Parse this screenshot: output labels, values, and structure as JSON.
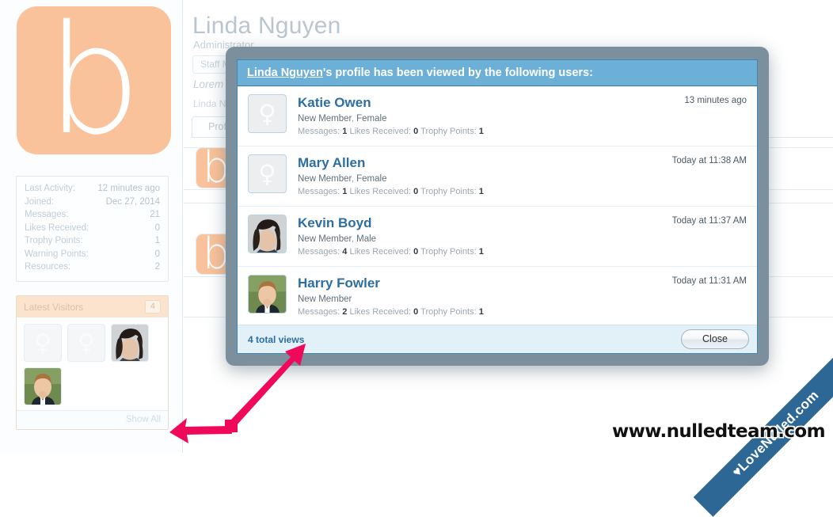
{
  "profile": {
    "username": "Linda Nguyen",
    "user_title": "Administrator",
    "staff_badge": "Staff Member",
    "tagline": "Lorem ipsum dolor sit amet",
    "subline": "Linda Nguyen",
    "avatar_letter": "b",
    "avatar_color": "#fac29a",
    "tab_profile": "Profile"
  },
  "stats": {
    "rows": [
      {
        "label": "Last Activity:",
        "value": "12 minutes ago"
      },
      {
        "label": "Joined:",
        "value": "Dec 27, 2014"
      },
      {
        "label": "Messages:",
        "value": "21"
      },
      {
        "label": "Likes Received:",
        "value": "0"
      },
      {
        "label": "Trophy Points:",
        "value": "1"
      },
      {
        "label": "Warning Points:",
        "value": "0"
      },
      {
        "label": "Resources:",
        "value": "2"
      }
    ]
  },
  "visitors": {
    "title": "Latest Visitors",
    "count": "4",
    "show_all": "Show All",
    "thumbs": [
      {
        "type": "female-symbol",
        "symbol": "♀"
      },
      {
        "type": "female-symbol",
        "symbol": "♀"
      },
      {
        "type": "photo-dark-hair",
        "symbol": ""
      },
      {
        "type": "photo-blond-man",
        "symbol": ""
      }
    ]
  },
  "modal": {
    "title_owner": "Linda Nguyen",
    "title_rest": "'s profile has been viewed by the following users:",
    "total_views": "4 total views",
    "close_label": "Close",
    "accent_color": "#6cafd7",
    "frame_color": "#7b8f9d",
    "rows": [
      {
        "name": "Katie Owen",
        "member_status": "New Member",
        "gender": "Female",
        "messages_label": "Messages:",
        "messages": "1",
        "likes_label": "Likes Received:",
        "likes": "0",
        "trophy_label": "Trophy Points:",
        "trophy": "1",
        "time": "13 minutes ago",
        "avatar_type": "female-symbol",
        "avatar_symbol": "♀"
      },
      {
        "name": "Mary Allen",
        "member_status": "New Member",
        "gender": "Female",
        "messages_label": "Messages:",
        "messages": "1",
        "likes_label": "Likes Received:",
        "likes": "0",
        "trophy_label": "Trophy Points:",
        "trophy": "1",
        "time": "Today at 11:38 AM",
        "avatar_type": "female-symbol",
        "avatar_symbol": "♀"
      },
      {
        "name": "Kevin Boyd",
        "member_status": "New Member",
        "gender": "Male",
        "messages_label": "Messages:",
        "messages": "4",
        "likes_label": "Likes Received:",
        "likes": "0",
        "trophy_label": "Trophy Points:",
        "trophy": "1",
        "time": "Today at 11:37 AM",
        "avatar_type": "photo-dark-hair",
        "avatar_symbol": ""
      },
      {
        "name": "Harry Fowler",
        "member_status": "New Member",
        "gender": "",
        "messages_label": "Messages:",
        "messages": "2",
        "likes_label": "Likes Received:",
        "likes": "0",
        "trophy_label": "Trophy Points:",
        "trophy": "1",
        "time": "Today at 11:31 AM",
        "avatar_type": "photo-blond-man",
        "avatar_symbol": ""
      }
    ]
  },
  "annotation": {
    "arrow_color": "#f0085a",
    "description": "double-headed arrow pointing to total views and show all"
  },
  "watermark": {
    "ribbon": "LoveNulled.com",
    "heart": "♥",
    "url": "www.nulledteam.com"
  }
}
